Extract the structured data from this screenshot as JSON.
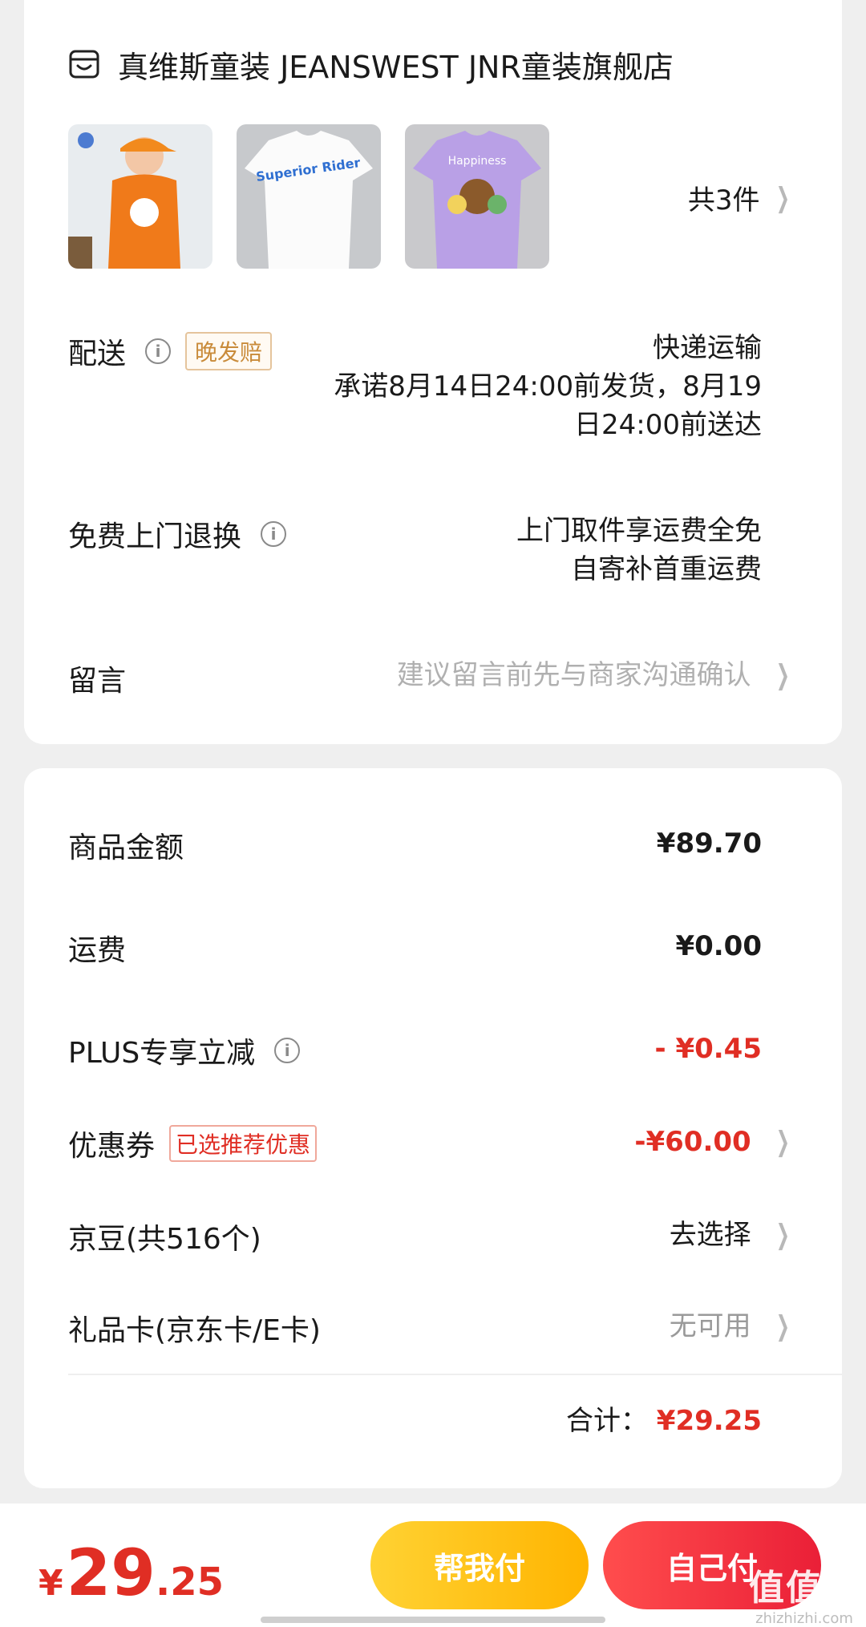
{
  "shop": {
    "name": "真维斯童装 JEANSWEST JNR童装旗舰店",
    "icon": "shop-icon"
  },
  "items": {
    "count_label": "共3件",
    "thumbnails": [
      {
        "name": "orange-kids-tee",
        "color": "#f07a1a"
      },
      {
        "name": "white-superior-rider-tee",
        "text": "Superior Rider",
        "color": "#ffffff"
      },
      {
        "name": "purple-happiness-tee",
        "text": "Happiness",
        "color": "#b9a0e6"
      }
    ]
  },
  "delivery": {
    "label": "配送",
    "tag": "晚发赔",
    "method": "快递运输",
    "promise_line1": "承诺8月14日24:00前发货，8月19",
    "promise_line2": "日24:00前送达"
  },
  "returns": {
    "label": "免费上门退换",
    "line1": "上门取件享运费全免",
    "line2": "自寄补首重运费"
  },
  "message": {
    "label": "留言",
    "placeholder": "建议留言前先与商家沟通确认"
  },
  "pricing": {
    "goods": {
      "label": "商品金额",
      "value": "¥89.70"
    },
    "shipping": {
      "label": "运费",
      "value": "¥0.00"
    },
    "plus": {
      "label": "PLUS专享立减",
      "value": "- ¥0.45"
    },
    "coupon": {
      "label": "优惠券",
      "tag": "已选推荐优惠",
      "value": "-¥60.00"
    },
    "jingdou": {
      "label": "京豆(共516个)",
      "value": "去选择"
    },
    "giftcard": {
      "label": "礼品卡(京东卡/E卡)",
      "value": "无可用"
    },
    "total_label": "合计：",
    "total_value": "¥29.25"
  },
  "bottom": {
    "currency": "¥",
    "amount_int": "29",
    "amount_dec": ".25",
    "help_pay": "帮我付",
    "self_pay": "自己付",
    "watermark_main": "值值值",
    "watermark_sub": "zhizhizhi.com"
  },
  "colors": {
    "accent_red": "#e02e24",
    "help_yellow": "#ffc21a",
    "self_red": "#f0283c"
  }
}
